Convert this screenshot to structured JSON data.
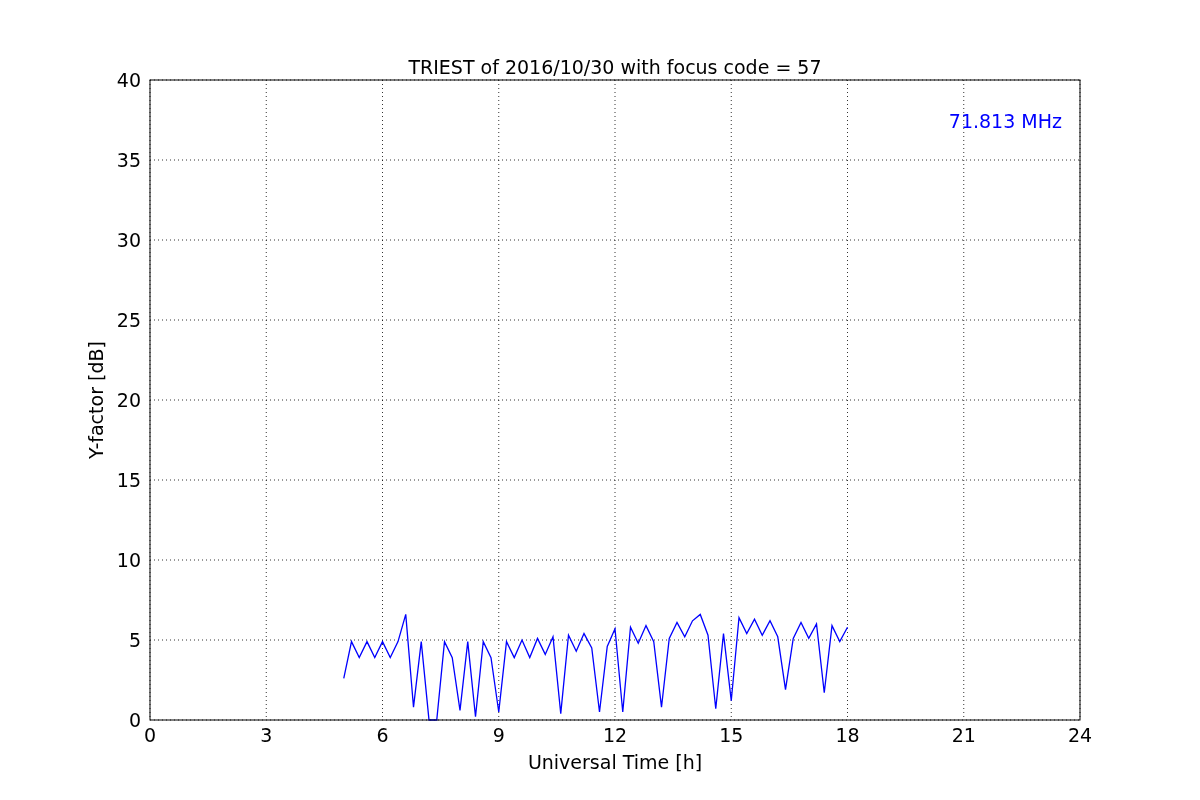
{
  "chart_data": {
    "type": "line",
    "title": "TRIEST of 2016/10/30 with focus code = 57",
    "xlabel": "Universal Time [h]",
    "ylabel": "Y-factor [dB]",
    "xlim": [
      0,
      24
    ],
    "ylim": [
      0,
      40
    ],
    "xticks": [
      0,
      3,
      6,
      9,
      12,
      15,
      18,
      21,
      24
    ],
    "yticks": [
      0,
      5,
      10,
      15,
      20,
      25,
      30,
      35,
      40
    ],
    "x": [
      5.0,
      5.2,
      5.4,
      5.6,
      5.8,
      6.0,
      6.2,
      6.4,
      6.6,
      6.8,
      7.0,
      7.2,
      7.4,
      7.6,
      7.8,
      8.0,
      8.2,
      8.4,
      8.6,
      8.8,
      9.0,
      9.2,
      9.4,
      9.6,
      9.8,
      10.0,
      10.2,
      10.4,
      10.6,
      10.8,
      11.0,
      11.2,
      11.4,
      11.6,
      11.8,
      12.0,
      12.2,
      12.4,
      12.6,
      12.8,
      13.0,
      13.2,
      13.4,
      13.6,
      13.8,
      14.0,
      14.2,
      14.4,
      14.6,
      14.8,
      15.0,
      15.2,
      15.4,
      15.6,
      15.8,
      16.0,
      16.2,
      16.4,
      16.6,
      16.8,
      17.0,
      17.2,
      17.4,
      17.6,
      17.8,
      18.0
    ],
    "series": [
      {
        "name": "71.813 MHz",
        "color": "#0000ff",
        "values": [
          2.6,
          4.9,
          3.9,
          4.9,
          3.9,
          4.9,
          3.9,
          4.9,
          6.6,
          0.8,
          4.9,
          0.0,
          0.0,
          4.9,
          3.9,
          0.6,
          4.9,
          0.2,
          4.9,
          3.9,
          0.5,
          4.9,
          3.9,
          5.0,
          3.9,
          5.1,
          4.1,
          5.2,
          0.4,
          5.3,
          4.3,
          5.4,
          4.5,
          0.5,
          4.6,
          5.7,
          0.5,
          5.8,
          4.8,
          5.9,
          4.9,
          0.8,
          5.1,
          6.1,
          5.2,
          6.2,
          6.6,
          5.3,
          0.7,
          5.4,
          1.2,
          6.4,
          5.4,
          6.3,
          5.3,
          6.2,
          5.2,
          1.9,
          5.1,
          6.1,
          5.1,
          6.0,
          1.7,
          5.9,
          4.9,
          5.8
        ]
      }
    ],
    "grid": true
  }
}
